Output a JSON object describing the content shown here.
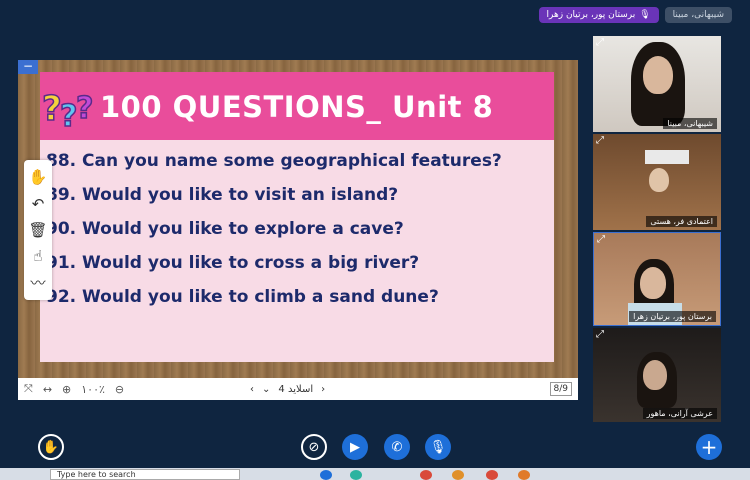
{
  "top_chips": [
    {
      "text": "شیبهانی، مبینا",
      "style": "gray"
    },
    {
      "text": "برستان پور، برتیان زهرا",
      "style": "purple",
      "icon": "mic-icon"
    }
  ],
  "slide": {
    "title": "100 QUESTIONS_ Unit 8",
    "questions": [
      "88. Can you name some geographical features?",
      "89. Would you like to visit an island?",
      "90. Would you like to explore a cave?",
      "91. Would you like to cross a big river?",
      "92. Would you like to climb a sand dune?"
    ],
    "colors": {
      "header": "#e94d9b",
      "body": "#f8dbe6",
      "text": "#1d2a6b"
    }
  },
  "toolbar_tools": [
    "hand-icon",
    "undo-icon",
    "trash-icon",
    "pointer-icon",
    "chart-icon"
  ],
  "control_bar": {
    "zoom": "۱۰۰٪",
    "slide_label": "اسلاید 4",
    "page_count": "8/9"
  },
  "video_tiles": [
    {
      "name": "شیبهانی، مبینا"
    },
    {
      "name": "اعتمادی فر، هستی"
    },
    {
      "name": "برستان پور، برتیان زهرا"
    },
    {
      "name": "عرشی آرانی، ماهور"
    }
  ],
  "taskbar": {
    "search_placeholder": "Type here to search"
  }
}
